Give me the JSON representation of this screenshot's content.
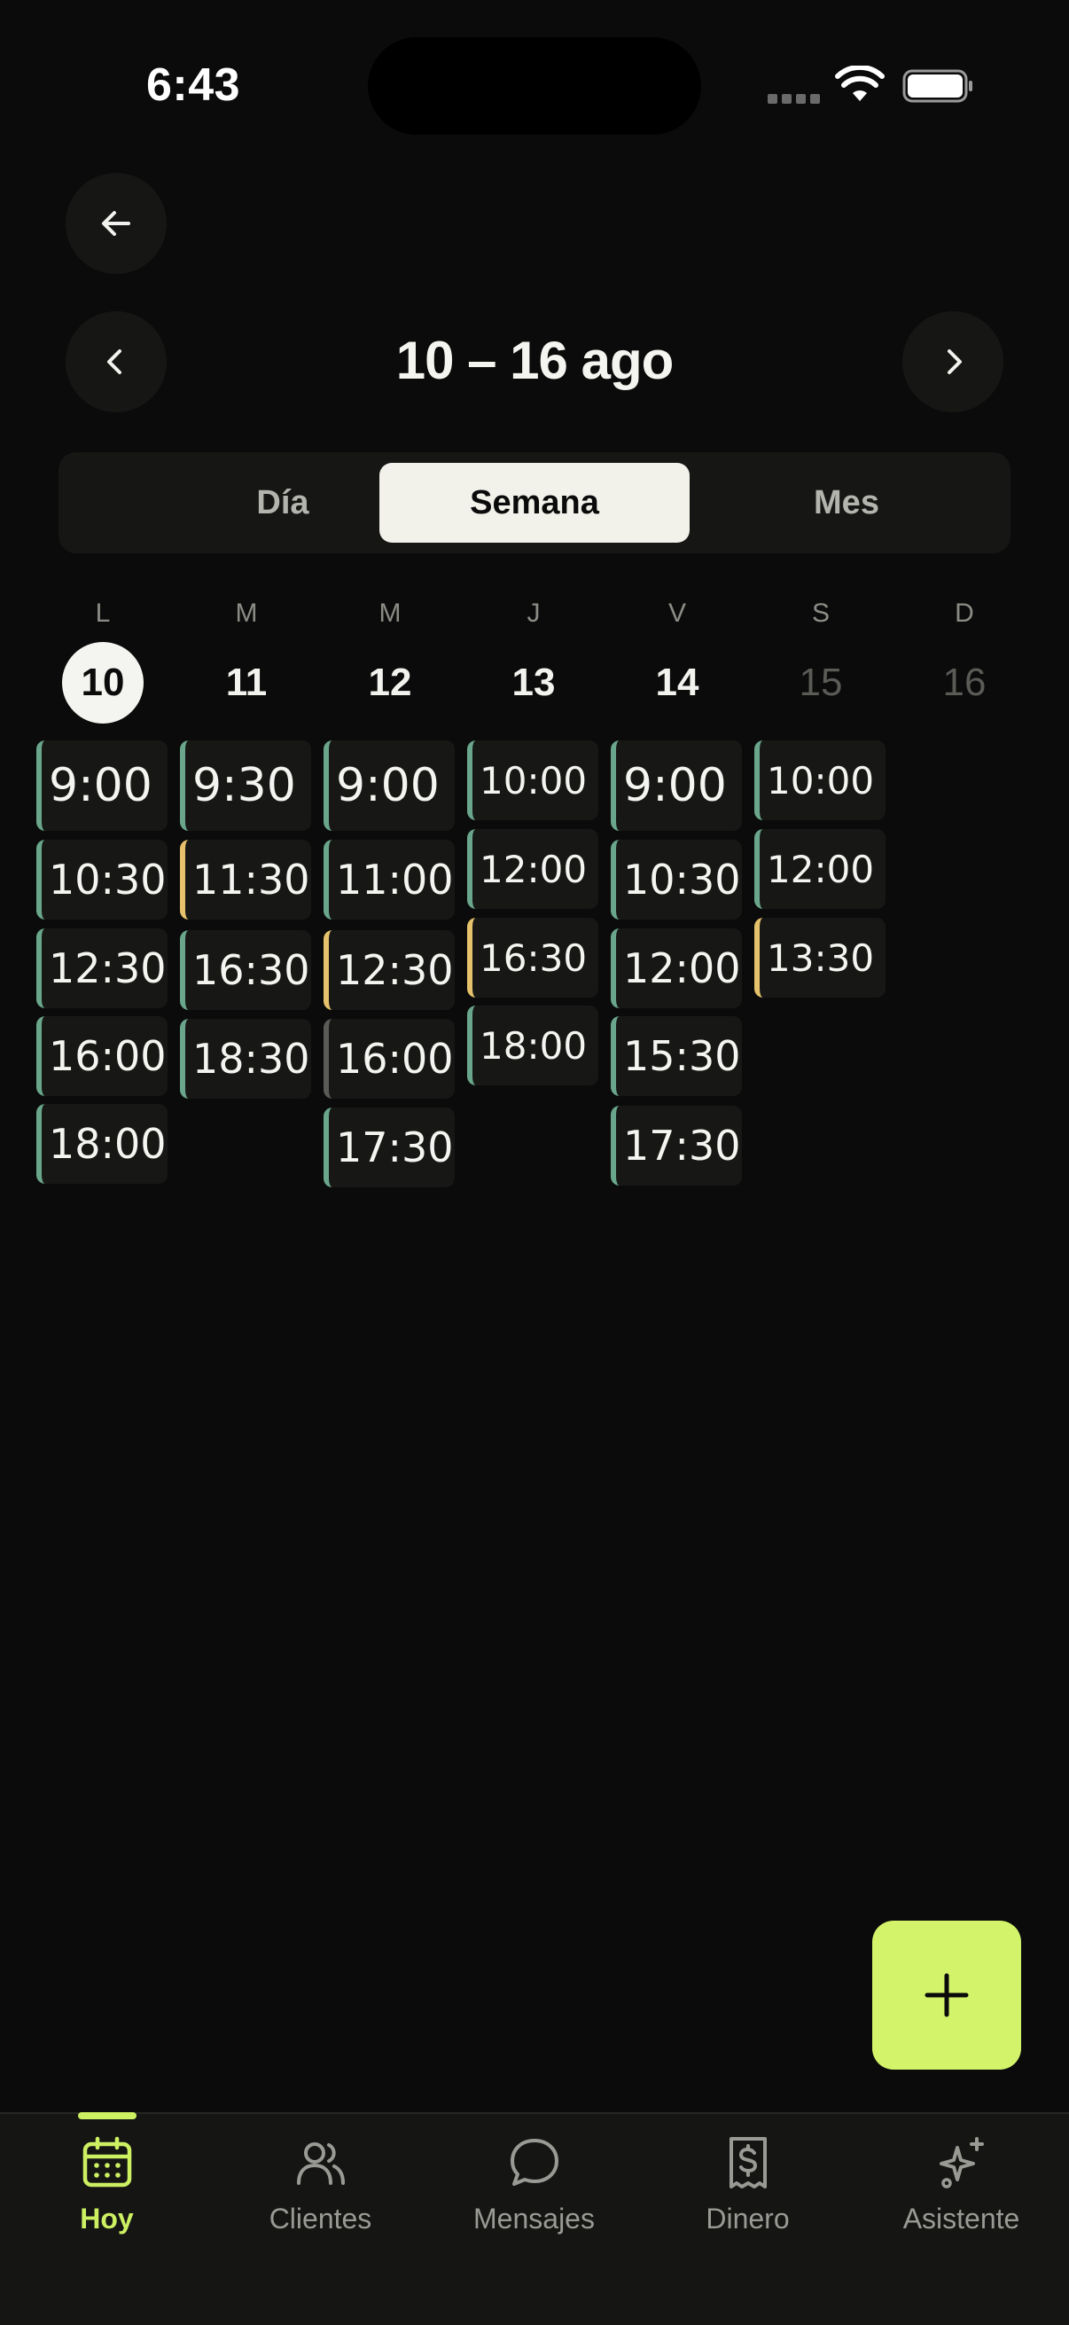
{
  "status_bar": {
    "time": "6:43"
  },
  "header": {
    "range_title": "10 – 16 ago"
  },
  "view_switch": {
    "items": [
      "Día",
      "Semana",
      "Mes"
    ],
    "selected": "Semana"
  },
  "colors": {
    "accent": "#cdf062",
    "confirmed": "#6aa68c",
    "pending": "#e5c26b",
    "cancelled": "#5a5a56"
  },
  "week": {
    "days": [
      {
        "weekday": "L",
        "date": "10"
      },
      {
        "weekday": "M",
        "date": "11"
      },
      {
        "weekday": "M",
        "date": "12"
      },
      {
        "weekday": "J",
        "date": "13"
      },
      {
        "weekday": "V",
        "date": "14"
      },
      {
        "weekday": "S",
        "date": "15"
      },
      {
        "weekday": "D",
        "date": "16"
      }
    ]
  },
  "appointments": {
    "mon": [
      {
        "time": "9:00",
        "status": "confirmed"
      },
      {
        "time": "10:30",
        "status": "confirmed"
      },
      {
        "time": "12:30",
        "status": "confirmed"
      },
      {
        "time": "16:00",
        "status": "confirmed"
      },
      {
        "time": "18:00",
        "status": "confirmed"
      }
    ],
    "tue": [
      {
        "time": "9:30",
        "status": "confirmed"
      },
      {
        "time": "11:30",
        "status": "pending"
      },
      {
        "time": "16:30",
        "status": "confirmed"
      },
      {
        "time": "18:30",
        "status": "confirmed"
      }
    ],
    "wed": [
      {
        "time": "9:00",
        "status": "confirmed"
      },
      {
        "time": "11:00",
        "status": "confirmed"
      },
      {
        "time": "12:30",
        "status": "pending"
      },
      {
        "time": "16:00",
        "status": "cancelled"
      },
      {
        "time": "17:30",
        "status": "confirmed"
      }
    ],
    "thu": [
      {
        "time": "10:00",
        "status": "confirmed"
      },
      {
        "time": "12:00",
        "status": "confirmed"
      },
      {
        "time": "16:30",
        "status": "pending"
      },
      {
        "time": "18:00",
        "status": "confirmed"
      }
    ],
    "fri": [
      {
        "time": "9:00",
        "status": "confirmed"
      },
      {
        "time": "10:30",
        "status": "confirmed"
      },
      {
        "time": "12:00",
        "status": "confirmed"
      },
      {
        "time": "15:30",
        "status": "confirmed"
      },
      {
        "time": "17:30",
        "status": "confirmed"
      }
    ],
    "sat": [
      {
        "time": "10:00",
        "status": "confirmed"
      },
      {
        "time": "12:00",
        "status": "confirmed"
      },
      {
        "time": "13:30",
        "status": "pending"
      }
    ]
  },
  "tabs": [
    {
      "label": "Hoy",
      "icon": "calendar-icon",
      "active": true
    },
    {
      "label": "Clientes",
      "icon": "users-icon",
      "active": false
    },
    {
      "label": "Mensajes",
      "icon": "message-icon",
      "active": false
    },
    {
      "label": "Dinero",
      "icon": "receipt-dollar-icon",
      "active": false
    },
    {
      "label": "Asistente",
      "icon": "sparkles-icon",
      "active": false
    }
  ]
}
